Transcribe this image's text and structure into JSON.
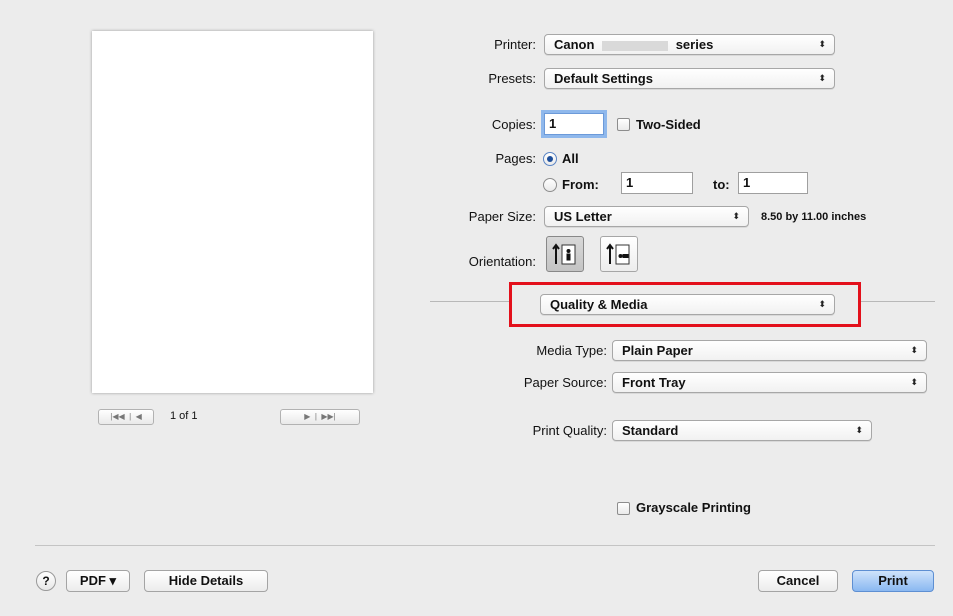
{
  "printer": {
    "label": "Printer:",
    "value": "Canon",
    "value_suffix": "series"
  },
  "presets": {
    "label": "Presets:",
    "value": "Default Settings"
  },
  "copies": {
    "label": "Copies:",
    "value": "1",
    "two_sided_label": "Two-Sided"
  },
  "pages": {
    "label": "Pages:",
    "all_label": "All",
    "from_label": "From:",
    "from_value": "1",
    "to_label": "to:",
    "to_value": "1"
  },
  "paper_size": {
    "label": "Paper Size:",
    "value": "US Letter",
    "dimensions": "8.50 by 11.00 inches"
  },
  "orientation": {
    "label": "Orientation:"
  },
  "section_popup": {
    "value": "Quality & Media"
  },
  "media_type": {
    "label": "Media Type:",
    "value": "Plain Paper"
  },
  "paper_source": {
    "label": "Paper Source:",
    "value": "Front Tray"
  },
  "print_quality": {
    "label": "Print Quality:",
    "value": "Standard"
  },
  "grayscale": {
    "label": "Grayscale Printing"
  },
  "preview": {
    "page_indicator": "1 of 1"
  },
  "footer": {
    "help": "?",
    "pdf": "PDF ▾",
    "hide_details": "Hide Details",
    "cancel": "Cancel",
    "print": "Print"
  },
  "popup_arrows": "⬍",
  "colors": {
    "highlight_box": "#e3101b",
    "focus_ring": "#8fb8ec",
    "default_button": "#8ab8f1"
  }
}
